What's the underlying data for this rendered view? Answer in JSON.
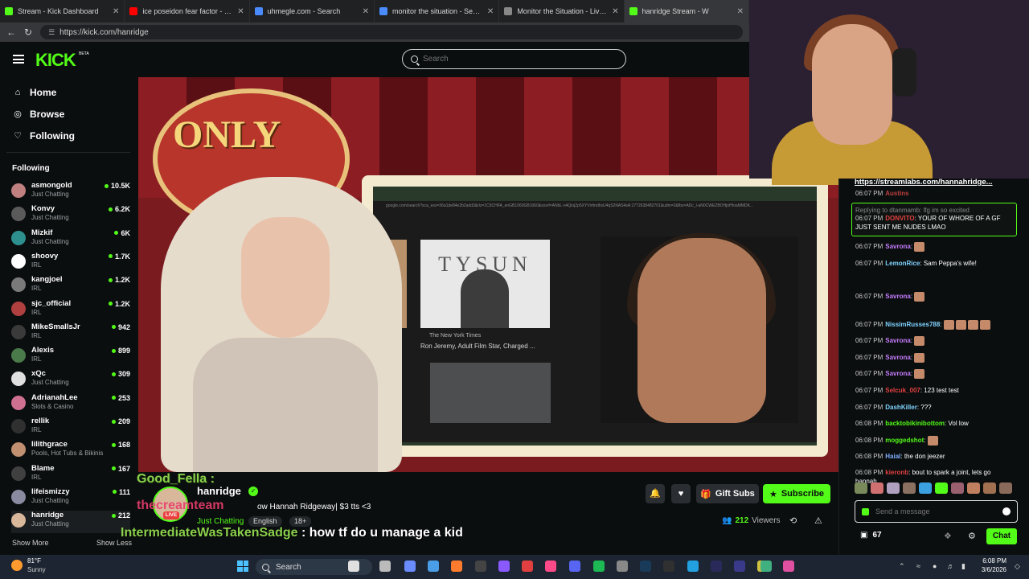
{
  "browser": {
    "tabs": [
      {
        "label": "Stream - Kick Dashboard",
        "color": "#53fc18",
        "active": false
      },
      {
        "label": "ice poseidon fear factor - YouTube",
        "color": "#ff0000",
        "active": false
      },
      {
        "label": "uhmegle.com - Search",
        "color": "#4a8cff",
        "active": false
      },
      {
        "label": "monitor the situation - Search",
        "color": "#4a8cff",
        "active": false
      },
      {
        "label": "Monitor the Situation - Live Global",
        "color": "#888888",
        "active": false
      },
      {
        "label": "hanridge Stream - W",
        "color": "#53fc18",
        "active": true
      }
    ],
    "url": "https://kick.com/hanridge"
  },
  "kick": {
    "logo": "KICK",
    "logo_beta": "BETA",
    "search_placeholder": "Search",
    "brand_color": "#53fc18"
  },
  "sidebar": {
    "nav": [
      {
        "label": "Home",
        "icon": "home-icon"
      },
      {
        "label": "Browse",
        "icon": "compass-icon"
      },
      {
        "label": "Following",
        "icon": "heart-icon"
      }
    ],
    "following_header": "Following",
    "channels": [
      {
        "name": "asmongold",
        "category": "Just Chatting",
        "viewers": "10.5K",
        "color": "#c08080"
      },
      {
        "name": "Konvy",
        "category": "Just Chatting",
        "viewers": "6.2K",
        "color": "#5a5a5a"
      },
      {
        "name": "Mizkif",
        "category": "Just Chatting",
        "viewers": "6K",
        "color": "#2e8f8f"
      },
      {
        "name": "shoovy",
        "category": "IRL",
        "viewers": "1.7K",
        "color": "#ffffff"
      },
      {
        "name": "kangjoel",
        "category": "IRL",
        "viewers": "1.2K",
        "color": "#7a7a7a"
      },
      {
        "name": "sjc_official",
        "category": "IRL",
        "viewers": "1.2K",
        "color": "#b04040"
      },
      {
        "name": "MikeSmallsJr",
        "category": "IRL",
        "viewers": "942",
        "color": "#3a3a3a"
      },
      {
        "name": "Alexis",
        "category": "IRL",
        "viewers": "899",
        "color": "#4a7a4a"
      },
      {
        "name": "xQc",
        "category": "Just Chatting",
        "viewers": "309",
        "color": "#e0e0e0"
      },
      {
        "name": "AdrianahLee",
        "category": "Slots & Casino",
        "viewers": "253",
        "color": "#d07090"
      },
      {
        "name": "rellik",
        "category": "IRL",
        "viewers": "209",
        "color": "#303030"
      },
      {
        "name": "lilithgrace",
        "category": "Pools, Hot Tubs & Bikinis",
        "viewers": "168",
        "color": "#c09070"
      },
      {
        "name": "Blame",
        "category": "IRL",
        "viewers": "167",
        "color": "#404040"
      },
      {
        "name": "lifeismizzy",
        "category": "Just Chatting",
        "viewers": "111",
        "color": "#8a8aa0"
      },
      {
        "name": "hanridge",
        "category": "Just Chatting",
        "viewers": "212",
        "color": "#d9b79a"
      }
    ],
    "show_more": "Show More",
    "show_less": "Show Less"
  },
  "stream": {
    "sign_text": "ONLY",
    "screen_url": "google.com/search?sca_esv=36a1de84e2b2add3&rlz=1C5CHFA_enGB1060GB1060&sxsrf=ANbL-n4Qioj2p5XYVnfmdhsU4qS2NAS4sA:1772638482701&udm=2&fbs=ADc_l-aN0CWEZBOHjofHoaMMDK...",
    "thumb_headline": "TYSUN",
    "thumb_source": "The New York Times",
    "thumb_caption": "Ron Jeremy, Adult Film Star, Charged ...",
    "overlay_user1": "Good_Fella :",
    "overlay_user2": "thecreamteam",
    "overlay_chat_user": "IntermediateWasTakenSadge",
    "overlay_chat_text": " : how tf do u manage a kid"
  },
  "info": {
    "streamer": "hanridge",
    "live_badge": "LIVE",
    "title": "ow  Hannah Ridgeway| $3 tts <3",
    "category": "Just Chatting",
    "tags": [
      "English",
      "18+"
    ],
    "gift_subs_label": "Gift Subs",
    "subscribe_label": "Subscribe",
    "viewers_count": "212",
    "viewers_label": "Viewers"
  },
  "chat": {
    "pinned_link": "https://streamlabs.com/hannahridge...",
    "messages": [
      {
        "ts": "06:07 PM",
        "user": "Austins",
        "text": "",
        "color": "#c04040"
      },
      {
        "ts": "",
        "user": "",
        "text": "Replying to dtanmamb: lfg im so excited",
        "color": "#888888"
      },
      {
        "ts": "06:07 PM",
        "user": "DONVITO",
        "text": ": YOUR OF WHORE OF A GF JUST SENT ME NUDES LMAO",
        "color": "#e24040"
      },
      {
        "ts": "06:07 PM",
        "user": "Savrona",
        "text": ":",
        "color": "#c77dff"
      },
      {
        "ts": "06:07 PM",
        "user": "LemonRice",
        "text": ": Sam Peppa's wife!",
        "color": "#7fd3ff"
      },
      {
        "ts": "06:07 PM",
        "user": "Savrona",
        "text": ":",
        "color": "#c77dff"
      },
      {
        "ts": "06:07 PM",
        "user": "NissimRusses788",
        "text": ":",
        "color": "#7fd3ff"
      },
      {
        "ts": "06:07 PM",
        "user": "Savrona",
        "text": ":",
        "color": "#c77dff"
      },
      {
        "ts": "06:07 PM",
        "user": "Savrona",
        "text": ":",
        "color": "#c77dff"
      },
      {
        "ts": "06:07 PM",
        "user": "Savrona",
        "text": ":",
        "color": "#c77dff"
      },
      {
        "ts": "06:07 PM",
        "user": "Selcuk_007",
        "text": ": 123 test test",
        "color": "#e24040"
      },
      {
        "ts": "06:07 PM",
        "user": "DashKiller",
        "text": ": ???",
        "color": "#7fd3ff"
      },
      {
        "ts": "06:08 PM",
        "user": "backtobikinibottom",
        "text": ": Vol low",
        "color": "#53fc18"
      },
      {
        "ts": "06:08 PM",
        "user": "moggedshot",
        "text": ":",
        "color": "#53fc18"
      },
      {
        "ts": "06:08 PM",
        "user": "Haial",
        "text": ": the don jeezer",
        "color": "#7fb0ff"
      },
      {
        "ts": "06:08 PM",
        "user": "kieronb",
        "text": ": bout to spark a joint, lets go hannah",
        "color": "#e24040"
      }
    ],
    "input_placeholder": "Send a message",
    "points": "67",
    "chat_button": "Chat"
  },
  "taskbar": {
    "temp": "81°F",
    "condition": "Sunny",
    "search_label": "Search",
    "time": "6:08 PM",
    "date": "3/6/2026"
  }
}
